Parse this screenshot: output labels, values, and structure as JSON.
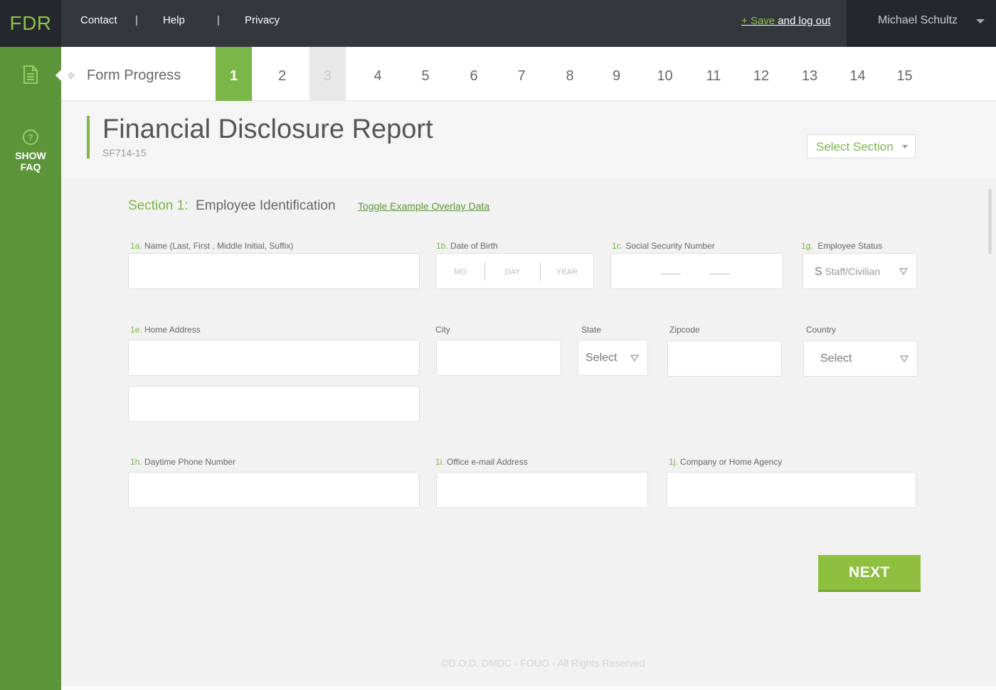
{
  "topbar": {
    "logo": "FDR",
    "nav": [
      "Contact",
      "|",
      "Help",
      "|",
      "Privacy"
    ],
    "save_plus": "+",
    "save_word": "Save",
    "save_rest": " and log out",
    "user_name": "Michael Schultz"
  },
  "sidebar": {
    "faq_line1": "SHOW",
    "faq_line2": "FAQ",
    "accent": "#5c943a"
  },
  "progress": {
    "label": "Form Progress",
    "steps": [
      "1",
      "2",
      "3",
      "4",
      "5",
      "6",
      "7",
      "8",
      "9",
      "10",
      "11",
      "12",
      "13",
      "14",
      "15"
    ],
    "active_step": "1",
    "disabled_step": "3"
  },
  "header": {
    "title": "Financial Disclosure Report",
    "subtitle": "SF714-15",
    "select_section": "Select Section"
  },
  "section": {
    "number": "Section 1",
    "colon": ":",
    "title": "Employee Identification",
    "toggle_link": "Toggle Example Overlay Data"
  },
  "fields": {
    "name": {
      "key": "1a.",
      "label": "Name (Last, First , Middle Initial, Suffix)",
      "value": ""
    },
    "dob": {
      "key": "1b.",
      "label": "Date of Birth",
      "mo": "MO",
      "day": "DAY",
      "year": "YEAR"
    },
    "ssn": {
      "key": "1c.",
      "label": "Social Security Number"
    },
    "status": {
      "key": "1g.",
      "label": "Employee Status",
      "value_letter": "S",
      "value_text": "Staff/Civilian"
    },
    "address": {
      "key": "1e.",
      "label": "Home Address",
      "line1": "",
      "line2": ""
    },
    "city": {
      "label": "City",
      "value": ""
    },
    "state": {
      "label": "State",
      "value": "Select"
    },
    "zip": {
      "label": "Zipcode",
      "value": ""
    },
    "country": {
      "label": "Country",
      "value": "Select"
    },
    "phone": {
      "key": "1h.",
      "label": "Daytime Phone Number",
      "value": ""
    },
    "email": {
      "key": "1i.",
      "label": "Office e-mail Address",
      "value": ""
    },
    "agency": {
      "key": "1j.",
      "label": "Company or Home Agency",
      "value": ""
    }
  },
  "actions": {
    "next": "NEXT"
  },
  "footer": {
    "text": "©D.O.D.  DMDC - FOUO - All Rights Reserved"
  },
  "colors": {
    "brand_green": "#7ab648",
    "topbar_bg": "#34383d",
    "next_button": "#8fbf3f"
  }
}
